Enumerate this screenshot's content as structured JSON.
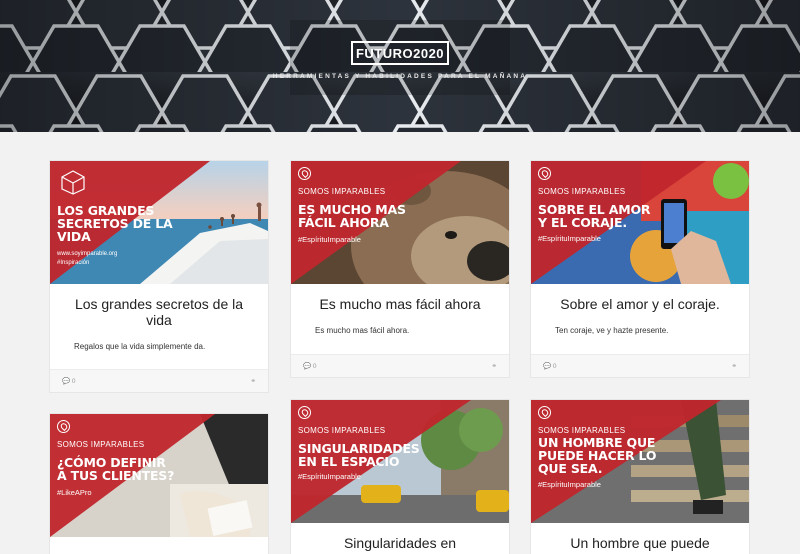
{
  "site": {
    "brand": "FUTURO2020",
    "tagline": "HERRAMIENTAS Y HABILIDADES PARA EL MAÑANA"
  },
  "cards": [
    {
      "thumb": {
        "headline": "LOS GRANDES SECRETOS DE LA VIDA",
        "url": "www.soyimparable.org",
        "hashtag": "#Inspiración",
        "icon": "cube-icon"
      },
      "title": "Los grandes secretos de la vida",
      "description": "Regalos que la vida simplemente da.",
      "comments": "0"
    },
    {
      "thumb": {
        "kicker": "SOMOS IMPARABLES",
        "headline": "ES MUCHO MAS FÁCIL AHORA",
        "hashtag": "#EspírituImparable",
        "icon": "pin-icon"
      },
      "title": "Es mucho mas fácil ahora",
      "description": "Es mucho mas fácil ahora.",
      "comments": "0"
    },
    {
      "thumb": {
        "kicker": "SOMOS IMPARABLES",
        "headline": "SOBRE EL AMOR Y EL CORAJE.",
        "hashtag": "#EspírituImparable",
        "icon": "pin-icon"
      },
      "title": "Sobre el amor y el coraje.",
      "description": "Ten coraje, ve y hazte presente.",
      "comments": "0"
    },
    {
      "thumb": {
        "kicker": "SOMOS IMPARABLES",
        "headline": "¿CÓMO DEFINIR A TUS CLIENTES?",
        "hashtag": "#LikeAPro",
        "icon": "pin-icon"
      },
      "title": "",
      "description": "",
      "comments": ""
    },
    {
      "thumb": {
        "kicker": "SOMOS IMPARABLES",
        "headline": "SINGULARIDADES EN EL ESPACIO",
        "hashtag": "#EspírituImparable",
        "icon": "pin-icon"
      },
      "title": "Singularidades en",
      "description": "",
      "comments": ""
    },
    {
      "thumb": {
        "kicker": "SOMOS IMPARABLES",
        "headline": "UN HOMBRE QUE PUEDE HACER LO QUE SEA.",
        "hashtag": "#EspírituImparable",
        "icon": "pin-icon"
      },
      "title": "Un hombre que puede",
      "description": "",
      "comments": ""
    }
  ],
  "colors": {
    "brand_red": "#c0272d",
    "page_bg": "#f2f2f2"
  }
}
